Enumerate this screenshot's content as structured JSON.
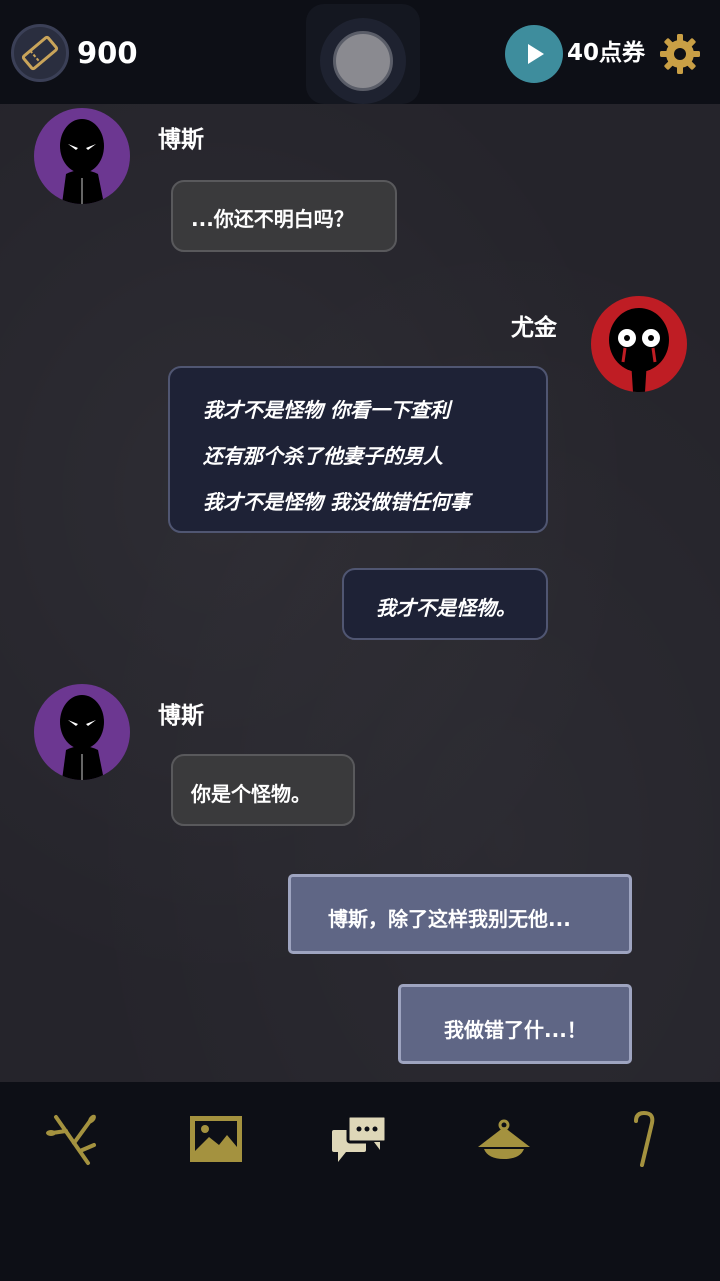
{
  "header": {
    "ticket_count": "900",
    "points_label": "40点券",
    "icons": [
      "ticket-icon",
      "play-icon",
      "gear-icon"
    ]
  },
  "messages": [
    {
      "speaker": "博斯",
      "lines": [
        "...你还不明白吗？"
      ],
      "style": "gray"
    },
    {
      "speaker": "尤金",
      "lines": [
        "我才不是怪物 你看一下查利",
        "还有那个杀了他妻子的男人",
        "我才不是怪物 我没做错任何事"
      ],
      "style": "navy"
    },
    {
      "lines": [
        "我才不是怪物。"
      ],
      "style": "navy"
    },
    {
      "speaker": "博斯",
      "lines": [
        "你是个怪物。"
      ],
      "style": "gray"
    },
    {
      "lines": [
        "博斯，除了这样我别无他..."
      ],
      "style": "blue"
    },
    {
      "lines": [
        "我做错了什...！"
      ],
      "style": "blue"
    }
  ],
  "bottom_nav": {
    "items": [
      "branch-icon",
      "gallery-icon",
      "chat-icon",
      "lamp-icon",
      "cane-icon"
    ],
    "active": "chat-icon"
  },
  "colors": {
    "topbar_bg": "#0d0f16",
    "chat_bg": "#25242b",
    "accent_gold": "#a4923f",
    "play_teal": "#3e8d9d",
    "boss_avatar_bg": "#6c3791",
    "eugene_avatar_bg": "#bf1d24"
  }
}
